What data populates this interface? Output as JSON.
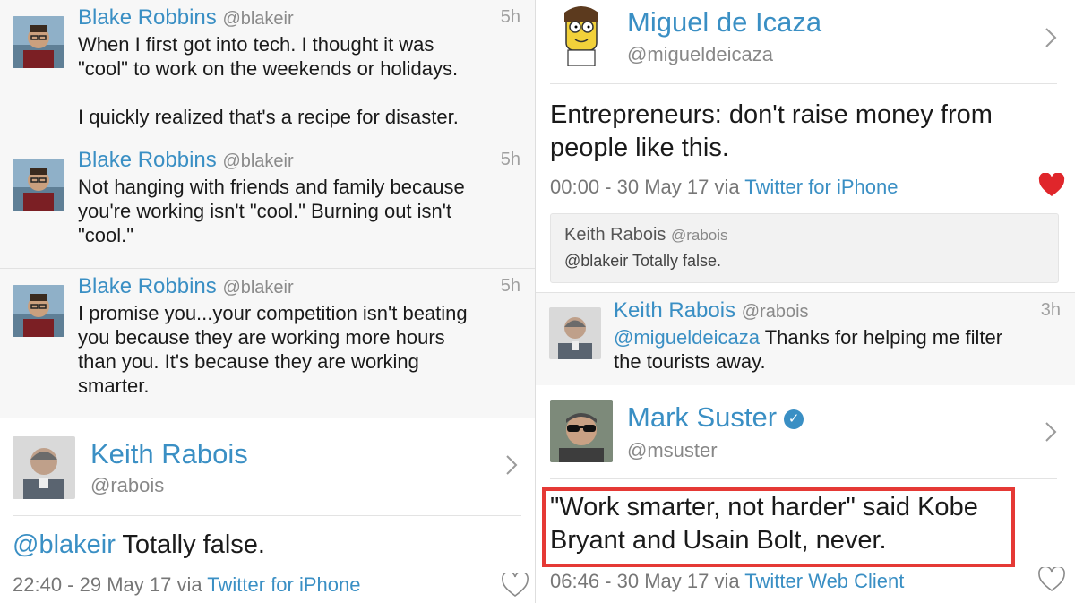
{
  "left_feed": {
    "tweets": [
      {
        "name": "Blake Robbins",
        "handle": "@blakeir",
        "time": "5h",
        "text": "When I first got into tech. I thought it was\n\"cool\" to work on the weekends or holidays.\n\nI quickly realized that's a recipe for disaster."
      },
      {
        "name": "Blake Robbins",
        "handle": "@blakeir",
        "time": "5h",
        "text": "Not hanging with friends and family because\nyou're working isn't \"cool.\" Burning out isn't\n\"cool.\""
      },
      {
        "name": "Blake Robbins",
        "handle": "@blakeir",
        "time": "5h",
        "text": "I promise you...your competition isn't beating\nyou because they are working more hours\nthan you. It's because they are working\nsmarter."
      }
    ],
    "detail": {
      "name": "Keith Rabois",
      "handle": "@rabois",
      "mention": "@blakeir",
      "text": " Totally false.",
      "meta_time": "22:40 - 29 May 17 via ",
      "via": "Twitter for iPhone"
    }
  },
  "right_feed": {
    "detail_top": {
      "name": "Miguel de Icaza",
      "handle": "@migueldeicaza",
      "text": "Entrepreneurs: don't raise money from\npeople like this.",
      "meta_time": "00:00 - 30 May 17 via ",
      "via": "Twitter for iPhone",
      "quote": {
        "name": "Keith Rabois",
        "handle": "@rabois",
        "text": "@blakeir Totally false."
      }
    },
    "reply": {
      "name": "Keith Rabois",
      "handle": "@rabois",
      "time": "3h",
      "mention": "@migueldeicaza",
      "text": " Thanks for helping me filter\nthe tourists away."
    },
    "detail_bottom": {
      "name": "Mark Suster",
      "handle": "@msuster",
      "text": "\"Work smarter, not harder\" said Kobe\nBryant and Usain Bolt, never.",
      "meta_time": "06:46 - 30 May 17 via ",
      "via": "Twitter Web Client"
    }
  },
  "colors": {
    "link": "#3a8fc4",
    "heart_red": "#e0262b",
    "highlight": "#e53935"
  },
  "icons": [
    "chevron-right-icon",
    "heart-outline-icon",
    "heart-filled-icon",
    "verified-badge-icon"
  ]
}
